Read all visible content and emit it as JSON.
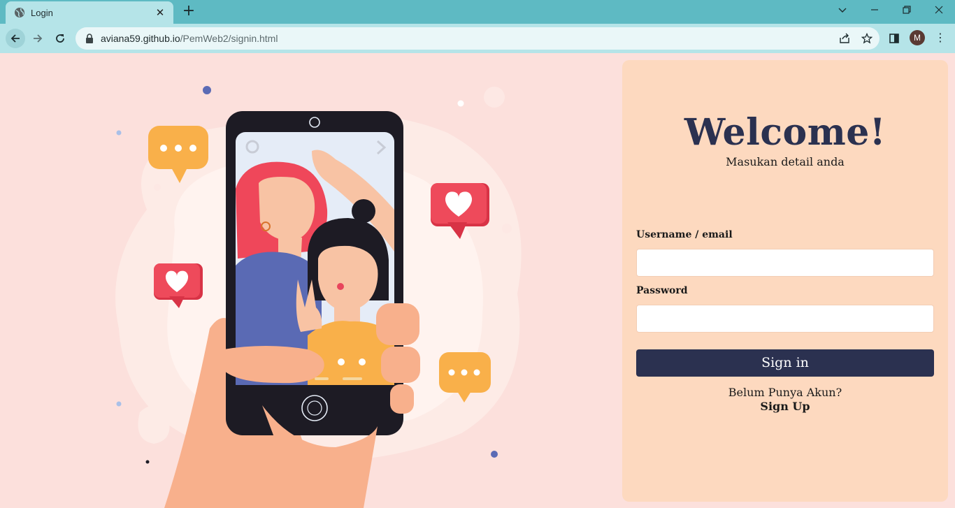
{
  "browser": {
    "tab": {
      "title": "Login",
      "close_glyph": "✕",
      "icon": "globe-icon"
    },
    "new_tab_glyph": "+",
    "window_controls": {
      "dropdown": "⌄",
      "minimize": "—",
      "restore": "❐",
      "close": "✕"
    },
    "address": {
      "host": "aviana59.github.io",
      "path": "/PemWeb2/signin.html"
    },
    "profile_initial": "M",
    "menu_glyph": "⋮",
    "accent_color": "#5ebac3"
  },
  "login": {
    "heading": "Welcome!",
    "subtitle": "Masukan detail anda",
    "username_label": "Username / email",
    "username_value": "",
    "password_label": "Password",
    "password_value": "",
    "submit_label": "Sign in",
    "no_account_text": "Belum Punya Akun?",
    "signup_label": "Sign Up",
    "card_color": "#fdd9bf",
    "button_color": "#2b3150"
  }
}
